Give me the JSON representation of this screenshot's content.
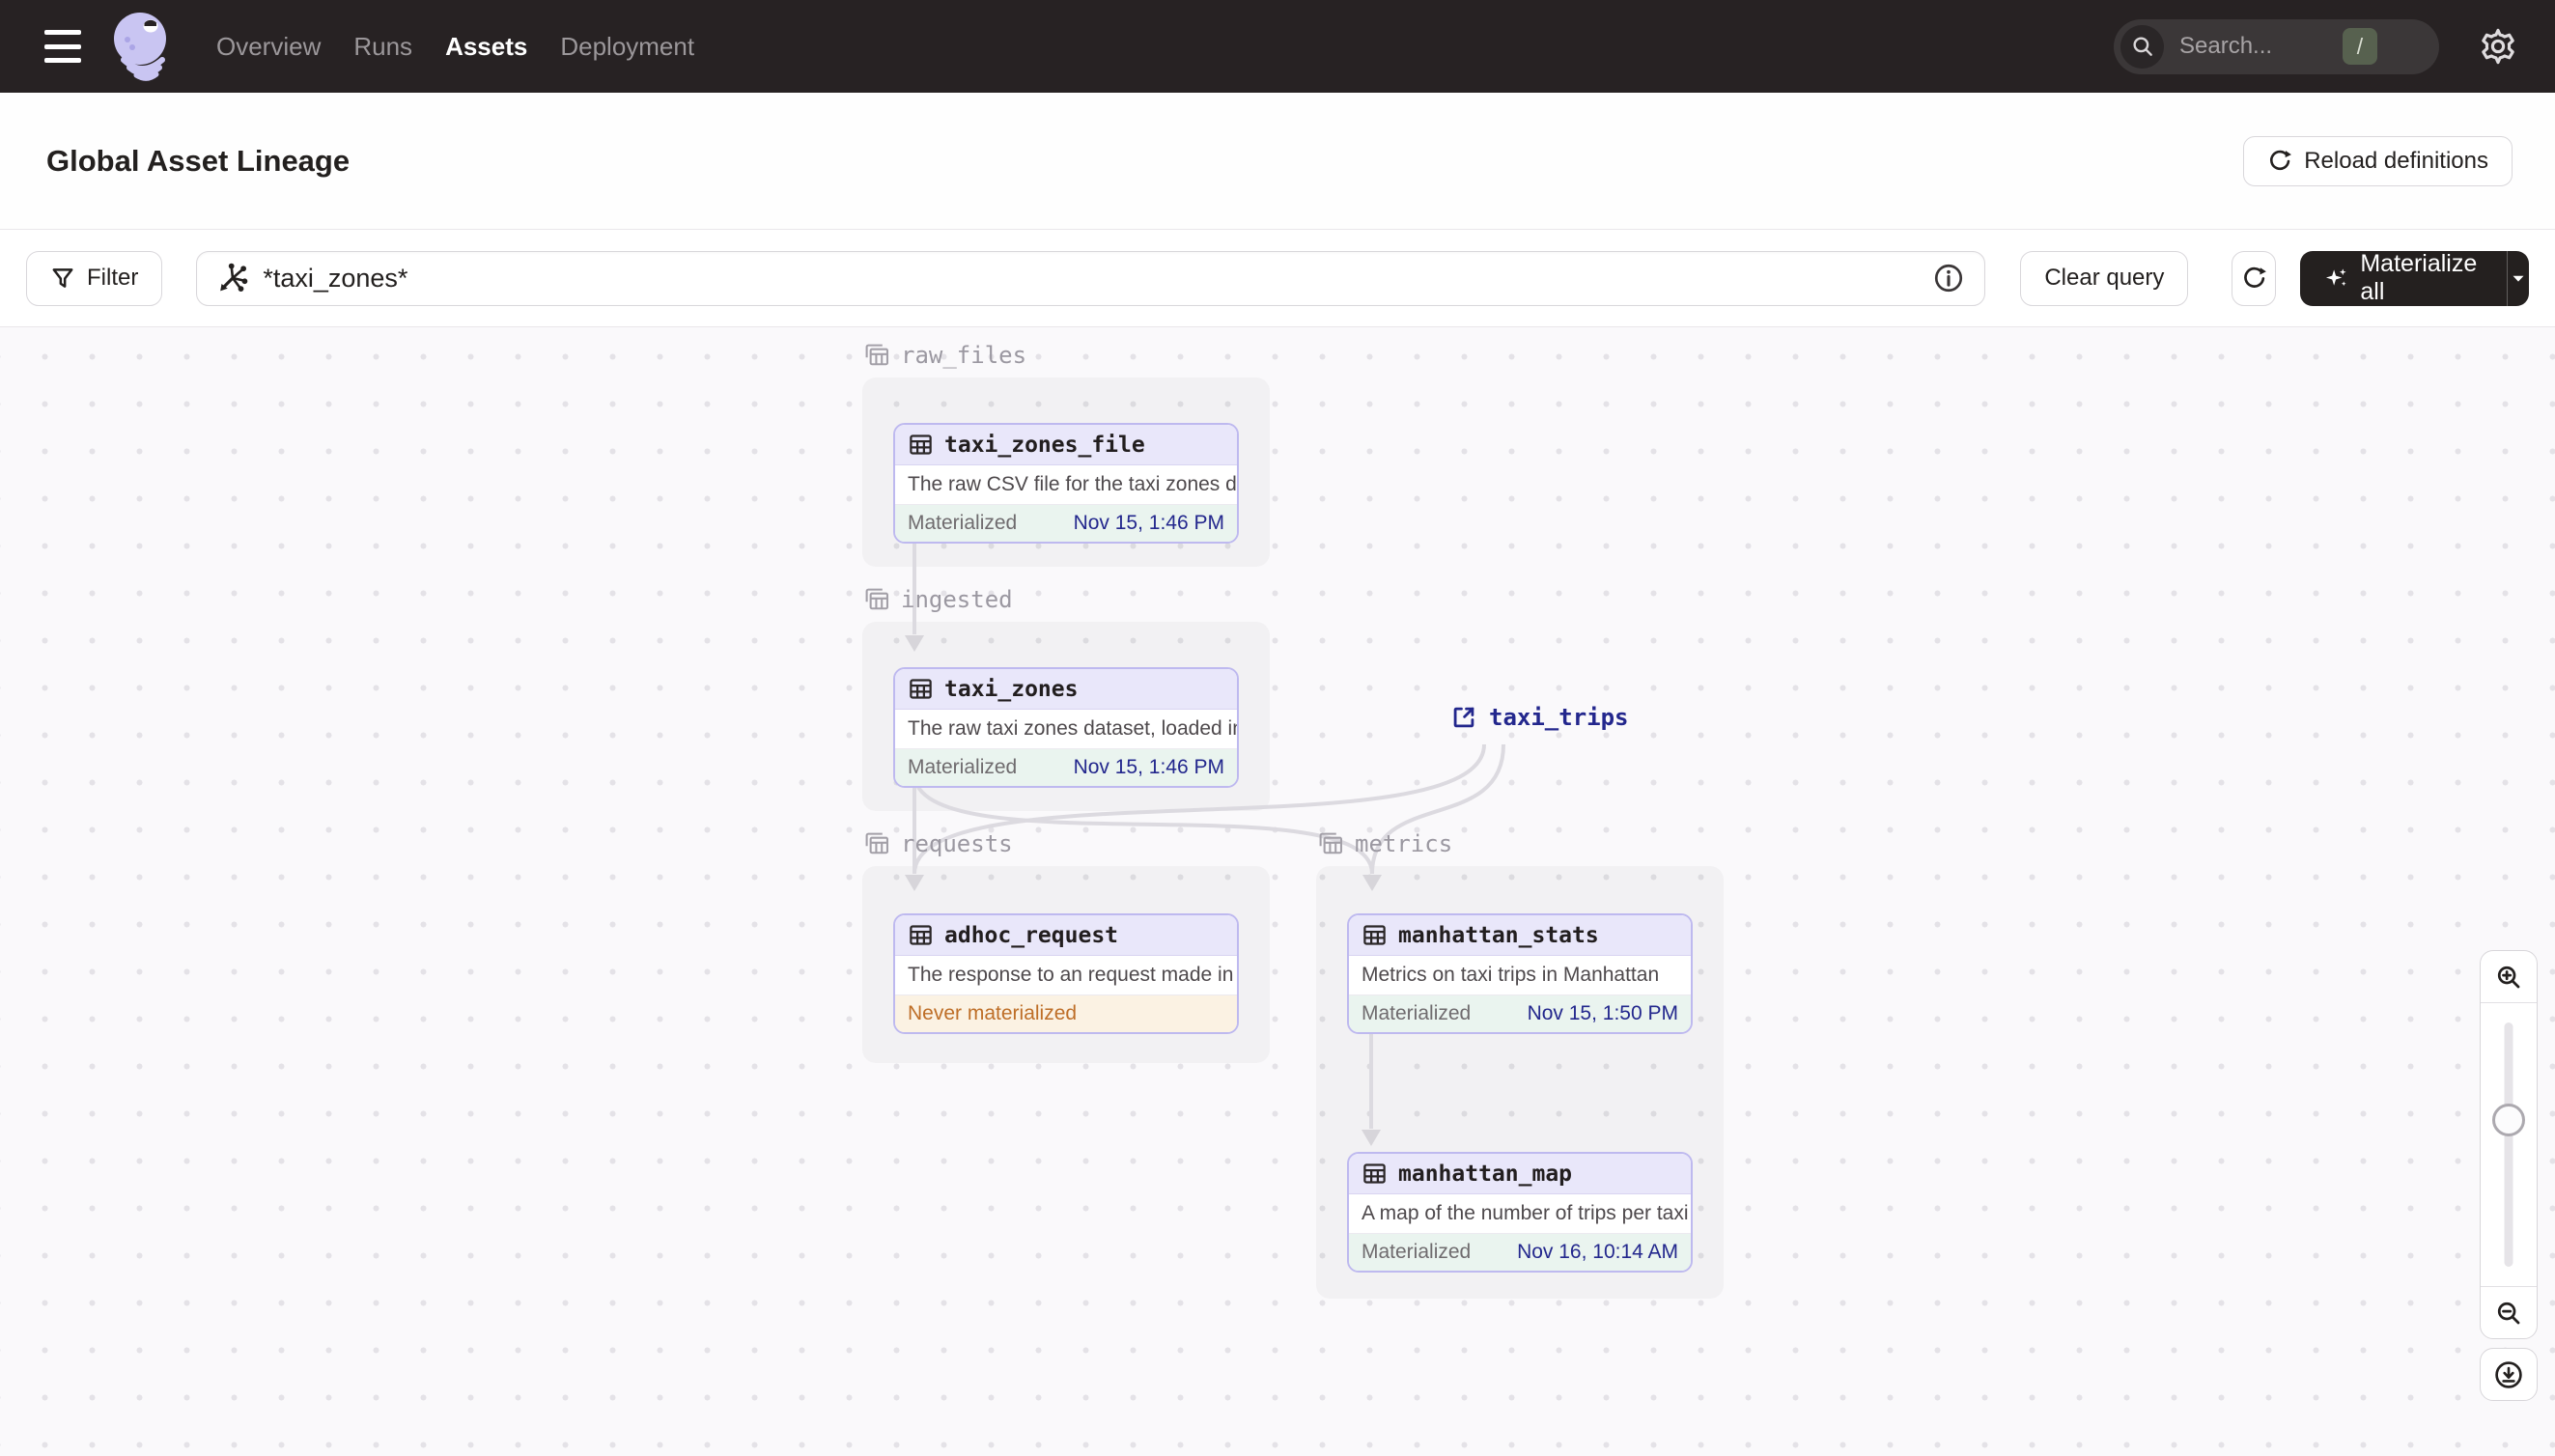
{
  "topnav": {
    "links": [
      {
        "label": "Overview",
        "active": false
      },
      {
        "label": "Runs",
        "active": false
      },
      {
        "label": "Assets",
        "active": true
      },
      {
        "label": "Deployment",
        "active": false
      }
    ],
    "search": {
      "placeholder": "Search...",
      "shortcut": "/"
    }
  },
  "header": {
    "title": "Global Asset Lineage",
    "reload_button": "Reload definitions"
  },
  "toolbar": {
    "filter_button": "Filter",
    "query_value": "*taxi_zones*",
    "clear_button": "Clear query",
    "materialize_button": "Materialize all"
  },
  "graph": {
    "groups": [
      {
        "name": "raw_files"
      },
      {
        "name": "ingested"
      },
      {
        "name": "requests"
      },
      {
        "name": "metrics"
      }
    ],
    "nodes": [
      {
        "name": "taxi_zones_file",
        "description": "The raw CSV file for the taxi zones dat...",
        "status": "Materialized",
        "date": "Nov 15, 1:46 PM"
      },
      {
        "name": "taxi_zones",
        "description": "The raw taxi zones dataset, loaded int...",
        "status": "Materialized",
        "date": "Nov 15, 1:46 PM"
      },
      {
        "name": "adhoc_request",
        "description": "The response to an request made in th...",
        "status": "Never materialized",
        "date": ""
      },
      {
        "name": "manhattan_stats",
        "description": "Metrics on taxi trips in Manhattan",
        "status": "Materialized",
        "date": "Nov 15, 1:50 PM"
      },
      {
        "name": "manhattan_map",
        "description": "A map of the number of trips per taxi z...",
        "status": "Materialized",
        "date": "Nov 16, 10:14 AM"
      }
    ],
    "external_asset": {
      "name": "taxi_trips"
    }
  },
  "icons": {
    "hamburger-icon": "three horizontal bars",
    "dagster-logo": "lavender octopus",
    "search-icon": "magnifier",
    "gear-icon": "settings gear",
    "filter-icon": "funnel",
    "asset-graph-icon": "node graph asterisk",
    "info-icon": "circled i",
    "refresh-icon": "circular arrow",
    "sparkles-icon": "materialize stars",
    "caret-down-icon": "dropdown triangle",
    "table-icon": "asset table grid",
    "group-tables-icon": "stacked tables",
    "external-link-icon": "box with arrow",
    "zoom-in-icon": "magnifier plus",
    "zoom-out-icon": "magnifier minus",
    "download-icon": "circled down arrow"
  },
  "colors": {
    "topbar_bg": "#272223",
    "brand_lavender": "#C9C5F2",
    "node_border": "#BEB9EF",
    "node_header_bg": "#E9E7FA",
    "materialized_bg": "#EAF4EF",
    "date_navy": "#23278D",
    "never_materialized_text": "#BE6E27",
    "never_materialized_bg": "#FBF2E3",
    "edge_gray": "#DCDAE0"
  }
}
